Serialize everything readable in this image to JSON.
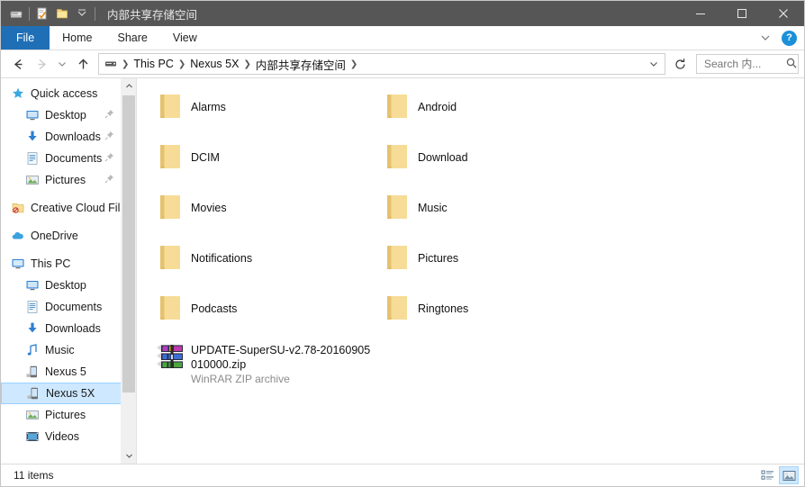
{
  "window": {
    "title": "内部共享存储空间",
    "quick_access_toolbar": [
      {
        "name": "properties-icon",
        "label": "Properties"
      },
      {
        "name": "new-folder-icon",
        "label": "New folder"
      },
      {
        "name": "customize-qat-chevron-icon",
        "label": "Customize Quick Access Toolbar"
      }
    ],
    "controls": {
      "minimize": "Minimize",
      "maximize": "Maximize",
      "close": "Close"
    }
  },
  "ribbon": {
    "tabs": [
      {
        "label": "File",
        "active": true
      },
      {
        "label": "Home",
        "active": false
      },
      {
        "label": "Share",
        "active": false
      },
      {
        "label": "View",
        "active": false
      }
    ],
    "expand_label": "Expand the Ribbon",
    "help_label": "?"
  },
  "address": {
    "back_label": "Back",
    "forward_label": "Forward",
    "recent_label": "Recent locations",
    "up_label": "Up",
    "breadcrumbs": [
      {
        "label": "This PC"
      },
      {
        "label": "Nexus 5X"
      },
      {
        "label": "内部共享存储空间"
      }
    ],
    "dropdown_label": "Previous locations",
    "refresh_label": "Refresh",
    "search_placeholder": "Search 内...",
    "search_value": ""
  },
  "sidebar": {
    "groups": [
      {
        "header": {
          "label": "Quick access",
          "icon": "star-icon"
        },
        "items": [
          {
            "label": "Desktop",
            "icon": "desktop-icon",
            "pinned": true
          },
          {
            "label": "Downloads",
            "icon": "download-icon",
            "pinned": true
          },
          {
            "label": "Documents",
            "icon": "documents-icon",
            "pinned": true
          },
          {
            "label": "Pictures",
            "icon": "pictures-icon",
            "pinned": true
          }
        ]
      },
      {
        "header": {
          "label": "Creative Cloud Files",
          "icon": "creative-cloud-icon"
        },
        "items": []
      },
      {
        "header": {
          "label": "OneDrive",
          "icon": "onedrive-cloud-icon"
        },
        "items": []
      },
      {
        "header": {
          "label": "This PC",
          "icon": "this-pc-icon"
        },
        "items": [
          {
            "label": "Desktop",
            "icon": "desktop-icon",
            "pinned": false
          },
          {
            "label": "Documents",
            "icon": "documents-icon",
            "pinned": false
          },
          {
            "label": "Downloads",
            "icon": "download-icon",
            "pinned": false
          },
          {
            "label": "Music",
            "icon": "music-icon",
            "pinned": false
          },
          {
            "label": "Nexus 5",
            "icon": "phone-icon",
            "pinned": false
          },
          {
            "label": "Nexus 5X",
            "icon": "phone-icon",
            "pinned": false,
            "selected": true
          },
          {
            "label": "Pictures",
            "icon": "pictures-icon",
            "pinned": false
          },
          {
            "label": "Videos",
            "icon": "videos-icon",
            "pinned": false
          }
        ]
      }
    ]
  },
  "files": {
    "items": [
      {
        "name": "Alarms",
        "type": "folder"
      },
      {
        "name": "Android",
        "type": "folder"
      },
      {
        "name": "DCIM",
        "type": "folder"
      },
      {
        "name": "Download",
        "type": "folder"
      },
      {
        "name": "Movies",
        "type": "folder"
      },
      {
        "name": "Music",
        "type": "folder"
      },
      {
        "name": "Notifications",
        "type": "folder"
      },
      {
        "name": "Pictures",
        "type": "folder"
      },
      {
        "name": "Podcasts",
        "type": "folder"
      },
      {
        "name": "Ringtones",
        "type": "folder"
      },
      {
        "name": "UPDATE-SuperSU-v2.78-20160905010000.zip",
        "type": "archive",
        "subtype": "WinRAR ZIP archive"
      }
    ]
  },
  "status": {
    "items_text": "11 items",
    "view_details_label": "Details view",
    "view_large_icons_label": "Large icons view"
  },
  "colors": {
    "titlebar": "#565656",
    "file_tab": "#1f6fb7",
    "folder": "#f7d67e",
    "selection": "#cde8ff",
    "help_blue": "#1b90d8"
  }
}
